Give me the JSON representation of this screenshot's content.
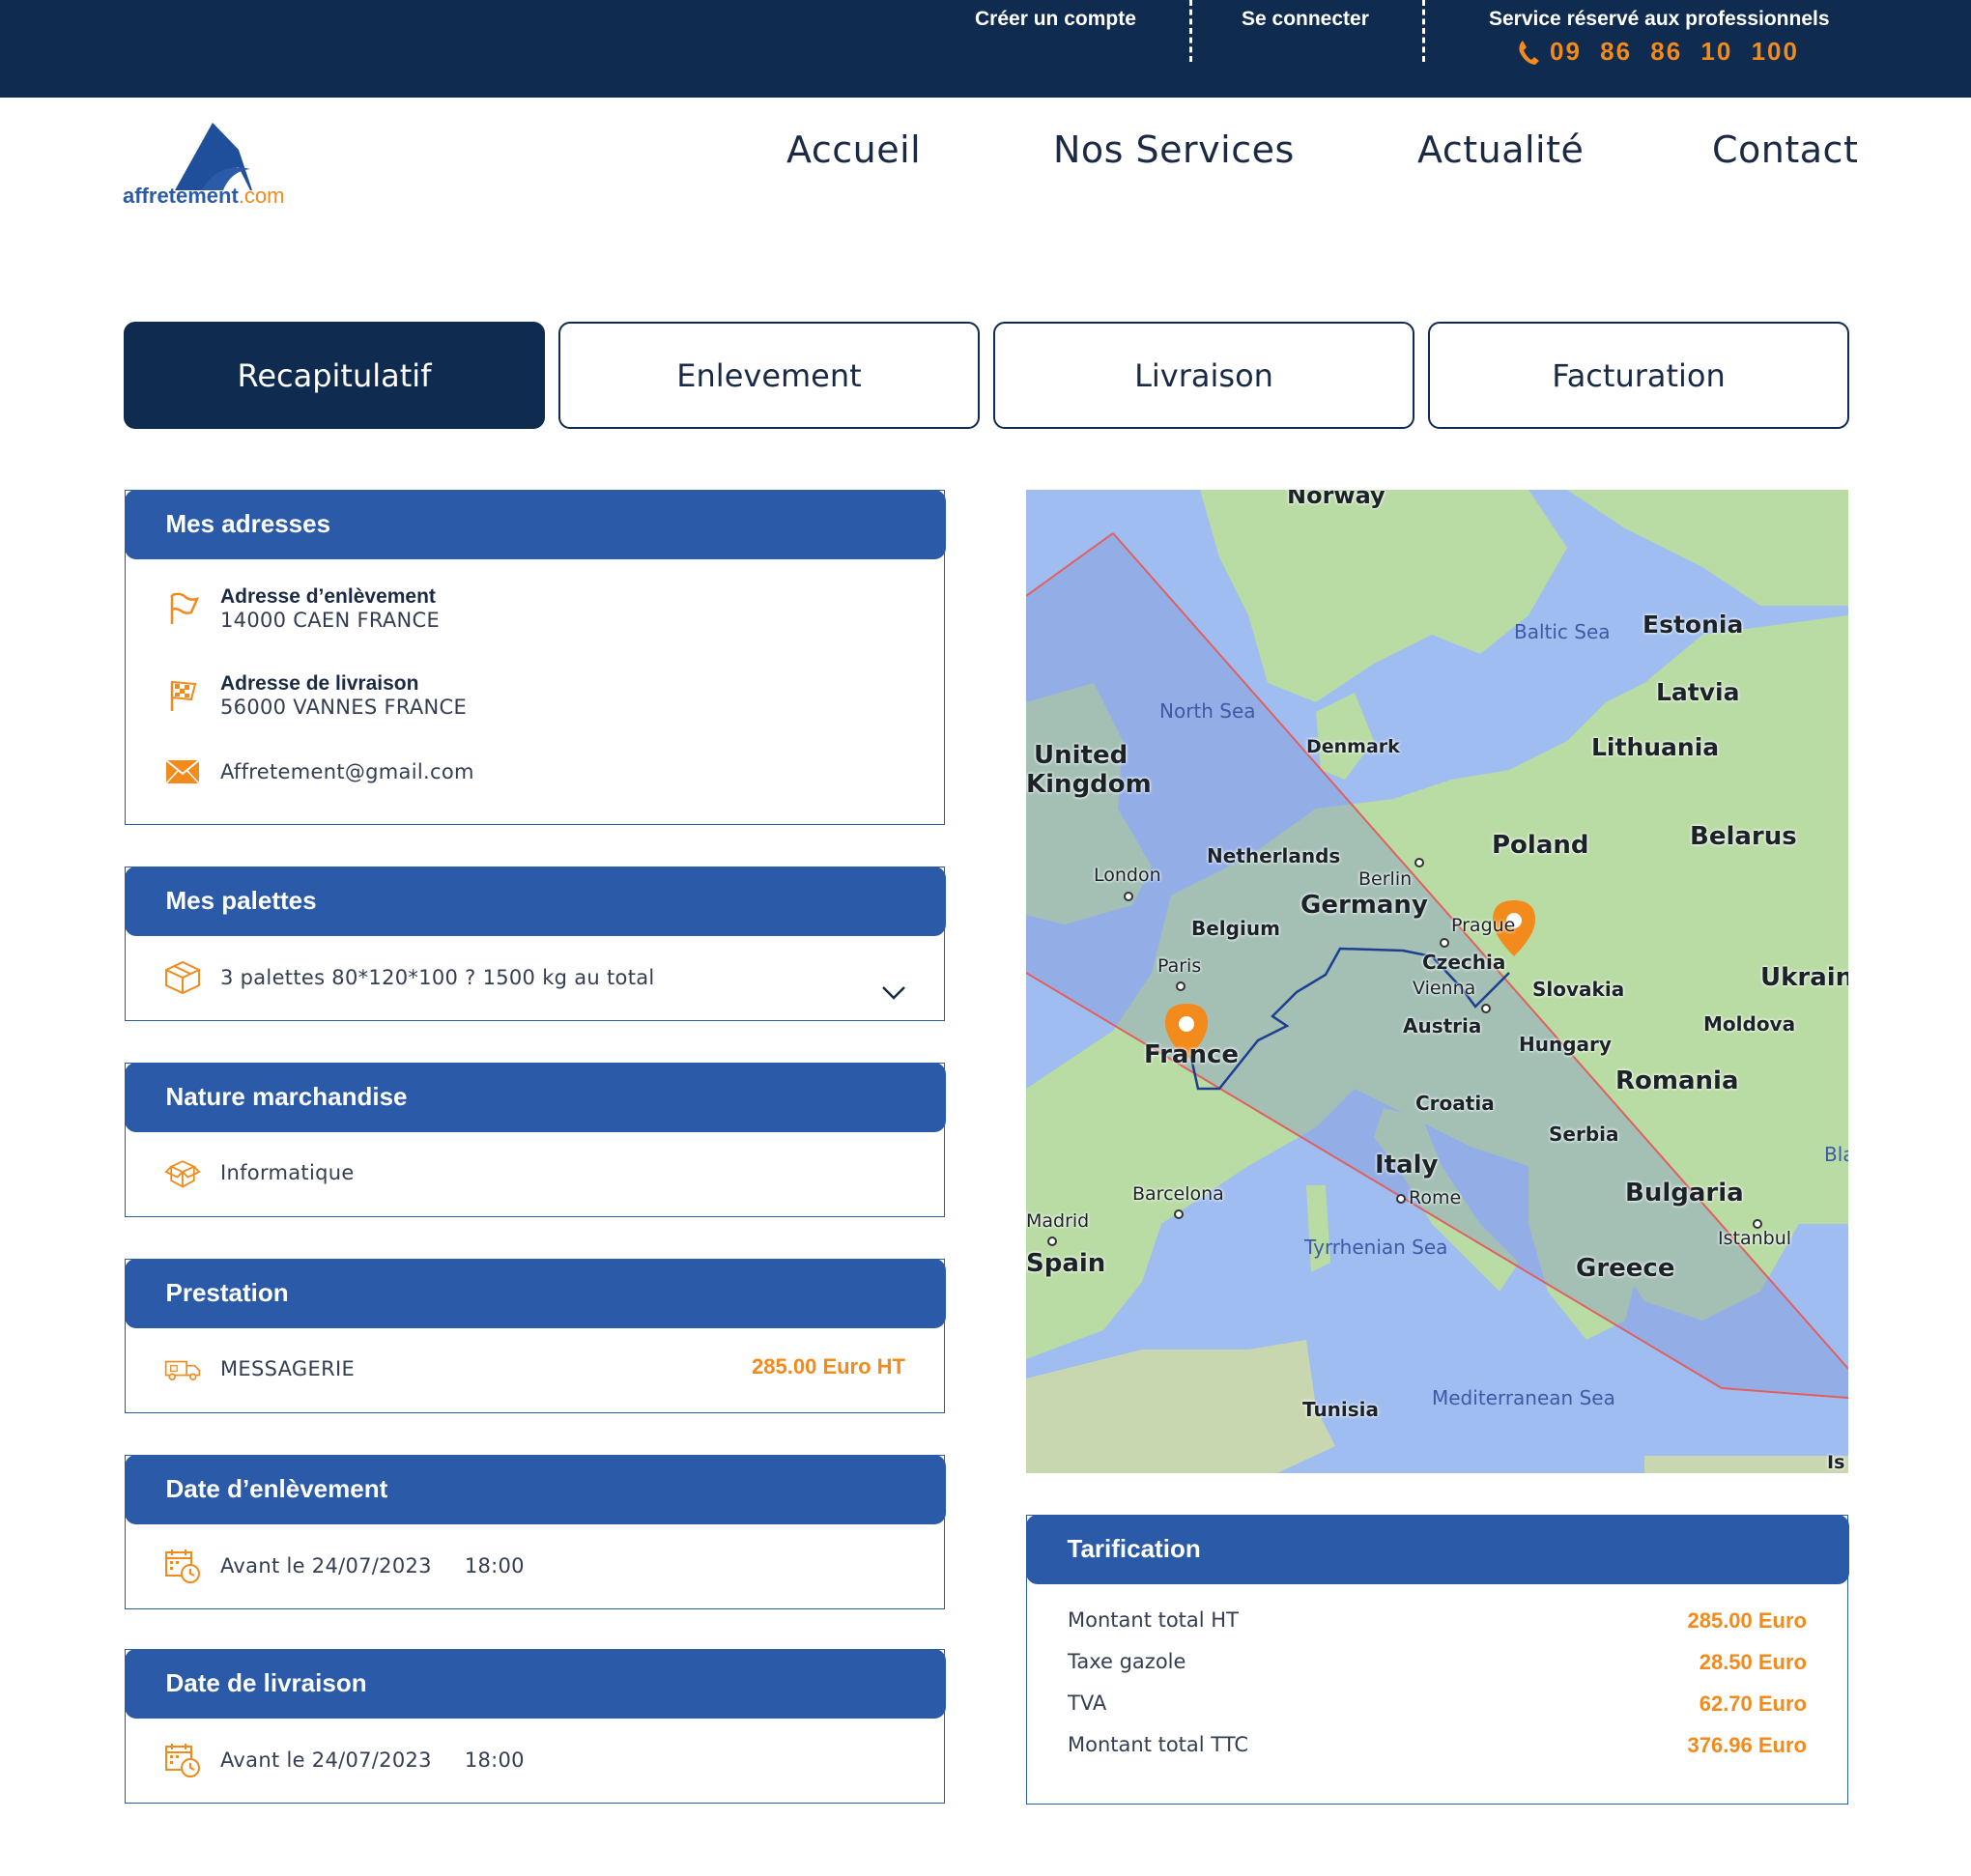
{
  "topbar": {
    "create_account": "Créer un compte",
    "login": "Se connecter",
    "pro_service": "Service réservé aux professionnels",
    "phone": "09 86 86 10 100"
  },
  "brand": {
    "name": "affretement",
    "suffix": ".com"
  },
  "nav": [
    "Accueil",
    "Nos Services",
    "Actualité",
    "Contact"
  ],
  "tabs": [
    "Recapitulatif",
    "Enlevement",
    "Livraison",
    "Facturation"
  ],
  "addresses": {
    "title": "Mes adresses",
    "pickup_label": "Adresse d’enlèvement",
    "pickup_value": "14000 CAEN FRANCE",
    "delivery_label": "Adresse de livraison",
    "delivery_value": "56000 VANNES FRANCE",
    "email": "Affretement@gmail.com"
  },
  "pallets": {
    "title": "Mes palettes",
    "value": "3 palettes 80*120*100 ? 1500 kg au total"
  },
  "goods": {
    "title": "Nature marchandise",
    "value": "Informatique"
  },
  "service": {
    "title": "Prestation",
    "value": "MESSAGERIE",
    "price": "285.00 Euro HT"
  },
  "pickup_date": {
    "title": "Date d’enlèvement",
    "date": "Avant le 24/07/2023",
    "time": "18:00"
  },
  "delivery_date": {
    "title": "Date de livraison",
    "date": "Avant le 24/07/2023",
    "time": "18:00"
  },
  "map": {
    "labels": {
      "norway": "Norway",
      "baltic": "Baltic Sea",
      "estonia": "Estonia",
      "latvia": "Latvia",
      "north_sea": "North Sea",
      "denmark": "Denmark",
      "lithuania": "Lithuania",
      "uk1": "United",
      "uk2": "Kingdom",
      "netherlands": "Netherlands",
      "berlin": "Berlin",
      "poland": "Poland",
      "belarus": "Belarus",
      "london": "London",
      "germany": "Germany",
      "belgium": "Belgium",
      "prague": "Prague",
      "czechia": "Czechia",
      "paris": "Paris",
      "vienna": "Vienna",
      "slovakia": "Slovakia",
      "ukraine": "Ukraine",
      "austria": "Austria",
      "moldova": "Moldova",
      "hungary": "Hungary",
      "france": "France",
      "romania": "Romania",
      "croatia": "Croatia",
      "serbia": "Serbia",
      "italy": "Italy",
      "bla": "Bla",
      "barcelona": "Barcelona",
      "rome": "Rome",
      "bulgaria": "Bulgaria",
      "madrid": "Madrid",
      "istanbul": "Istanbul",
      "spain": "Spain",
      "tyrrhenian": "Tyrrhenian Sea",
      "greece": "Greece",
      "tunisia": "Tunisia",
      "med": "Mediterranean Sea",
      "isl": "Is"
    },
    "colors": {
      "land": "#b9dba4",
      "water": "#9fbdf0",
      "route": "#1d3f8f",
      "pin": "#f28a1c",
      "corridor": "#e06060"
    }
  },
  "tarif": {
    "title": "Tarification",
    "lines": [
      {
        "label": "Montant total HT",
        "amount": "285.00 Euro"
      },
      {
        "label": "Taxe gazole",
        "amount": "28.50 Euro"
      },
      {
        "label": "TVA",
        "amount": "62.70 Euro"
      },
      {
        "label": "Montant total TTC",
        "amount": "376.96 Euro"
      }
    ]
  },
  "colors": {
    "navy": "#0f2b50",
    "blue": "#2a5aa8",
    "accent": "#f28a1c"
  }
}
